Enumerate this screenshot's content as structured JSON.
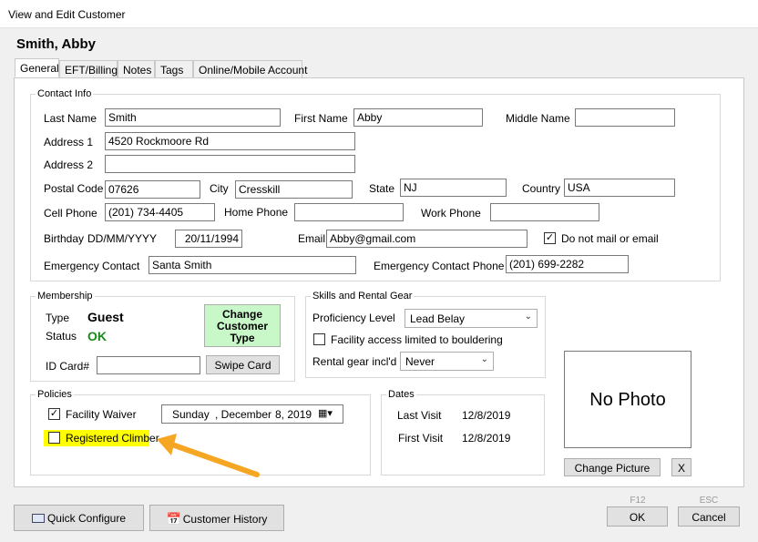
{
  "window": {
    "title": "View and Edit Customer"
  },
  "customer": {
    "name": "Smith, Abby"
  },
  "tabs": [
    "General",
    "EFT/Billing",
    "Notes",
    "Tags",
    "Online/Mobile Account"
  ],
  "contact": {
    "legend": "Contact Info",
    "last_name_label": "Last Name",
    "last_name": "Smith",
    "first_name_label": "First Name",
    "first_name": "Abby",
    "middle_name_label": "Middle Name",
    "middle_name": "",
    "address1_label": "Address 1",
    "address1": "4520 Rockmoore Rd",
    "address2_label": "Address 2",
    "address2": "",
    "postal_label": "Postal Code",
    "postal": "07626",
    "city_label": "City",
    "city": "Cresskill",
    "state_label": "State",
    "state": "NJ",
    "country_label": "Country",
    "country": "USA",
    "cell_label": "Cell Phone",
    "cell": "(201) 734-4405",
    "home_label": "Home Phone",
    "home": "",
    "work_label": "Work Phone",
    "work": "",
    "birthday_label": "Birthday",
    "birthday_format": "DD/MM/YYYY",
    "birthday": "20/11/1994",
    "email_label": "Email",
    "email": "Abby@gmail.com",
    "no_mail_label": "Do not mail or email",
    "no_mail_checked": true,
    "emergency_label": "Emergency Contact",
    "emergency": "Santa Smith",
    "emergency_phone_label": "Emergency Contact Phone",
    "emergency_phone": "(201) 699-2282"
  },
  "membership": {
    "legend": "Membership",
    "type_label": "Type",
    "type": "Guest",
    "status_label": "Status",
    "status": "OK",
    "status_color": "#1a8a1a",
    "change_type_label": "Change Customer Type",
    "change_type_color": "#c8f7c8",
    "id_card_label": "ID Card#",
    "id_card": "",
    "swipe_card_label": "Swipe Card"
  },
  "skills": {
    "legend": "Skills and Rental Gear",
    "proficiency_label": "Proficiency Level",
    "proficiency": "Lead Belay",
    "bouldering_label": "Facility access limited to bouldering",
    "bouldering_checked": false,
    "rental_label": "Rental gear incl'd",
    "rental": "Never"
  },
  "policies": {
    "legend": "Policies",
    "waiver_label": "Facility Waiver",
    "waiver_checked": true,
    "waiver_day": "Sunday",
    "waiver_month": ", December",
    "waiver_date": "8, 2019",
    "registered_label": "Registered Climber",
    "registered_checked": false,
    "highlight_color": "#ffff00"
  },
  "dates": {
    "legend": "Dates",
    "last_visit_label": "Last Visit",
    "last_visit": "12/8/2019",
    "first_visit_label": "First Visit",
    "first_visit": "12/8/2019"
  },
  "photo": {
    "placeholder": "No Photo",
    "change_label": "Change Picture",
    "remove_label": "X"
  },
  "footer": {
    "quick_configure_label": "Quick Configure",
    "history_label": "Customer History",
    "ok_hint": "F12",
    "ok_label": "OK",
    "cancel_hint": "ESC",
    "cancel_label": "Cancel"
  },
  "annotation": {
    "arrow_color": "#f5a623",
    "arrow_icon": "arrow-icon"
  }
}
